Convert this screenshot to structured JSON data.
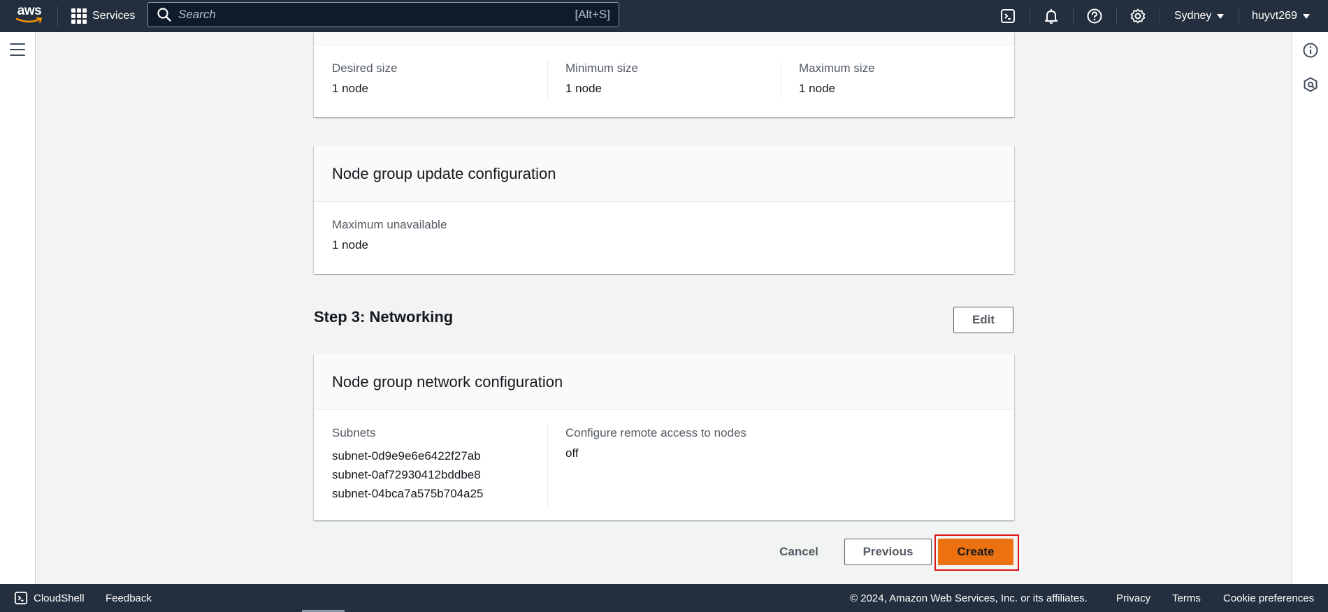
{
  "topnav": {
    "logo_text": "aws",
    "services_label": "Services",
    "search_placeholder": "Search",
    "search_shortcut": "[Alt+S]",
    "region": "Sydney",
    "user": "huyvt269"
  },
  "scaling": {
    "desired_label": "Desired size",
    "desired_value": "1 node",
    "min_label": "Minimum size",
    "min_value": "1 node",
    "max_label": "Maximum size",
    "max_value": "1 node"
  },
  "update_config": {
    "title": "Node group update configuration",
    "max_unavailable_label": "Maximum unavailable",
    "max_unavailable_value": "1 node"
  },
  "step3": {
    "title": "Step 3: Networking",
    "edit_label": "Edit"
  },
  "network": {
    "title": "Node group network configuration",
    "subnets_label": "Subnets",
    "subnets": [
      "subnet-0d9e9e6e6422f27ab",
      "subnet-0af72930412bddbe8",
      "subnet-04bca7a575b704a25"
    ],
    "remote_label": "Configure remote access to nodes",
    "remote_value": "off"
  },
  "actions": {
    "cancel": "Cancel",
    "previous": "Previous",
    "create": "Create"
  },
  "footer": {
    "cloudshell": "CloudShell",
    "feedback": "Feedback",
    "copyright": "© 2024, Amazon Web Services, Inc. or its affiliates.",
    "privacy": "Privacy",
    "terms": "Terms",
    "cookies": "Cookie preferences"
  },
  "colors": {
    "nav_bg": "#232f3e",
    "primary_button": "#ec7211",
    "highlight_border": "#d91515"
  }
}
